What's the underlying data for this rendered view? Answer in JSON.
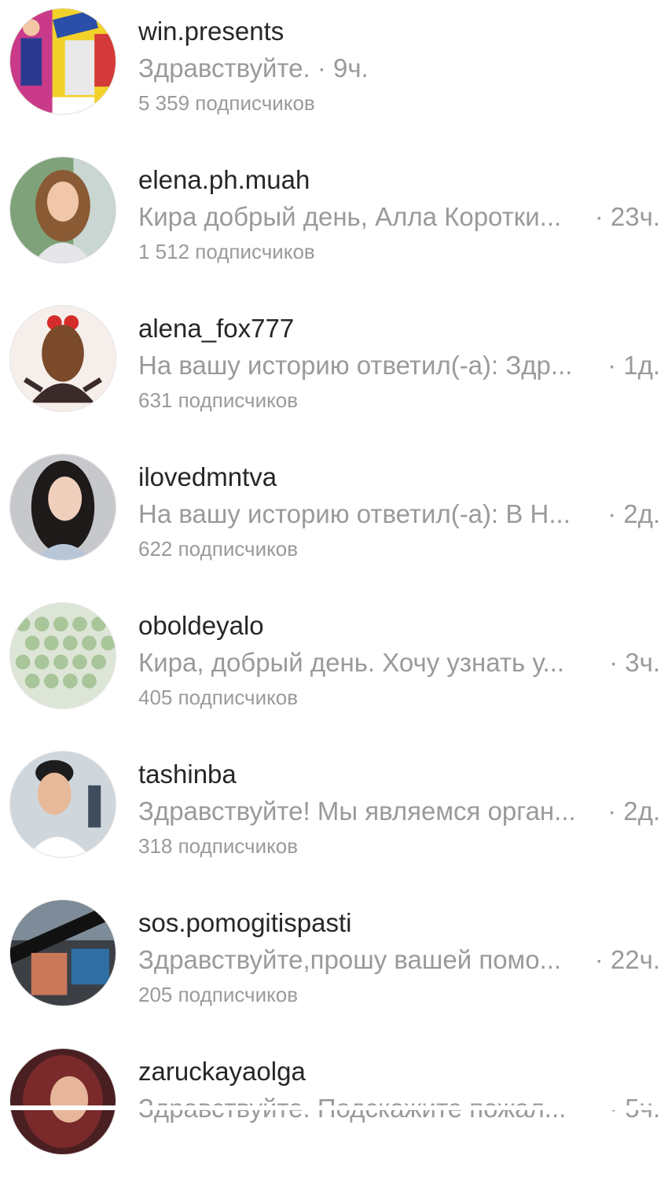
{
  "conversations": [
    {
      "username": "win.presents",
      "preview": "Здравствуйте. · 9ч.",
      "time": "",
      "followers": "5 359 подписчиков",
      "avatar": "product-collage"
    },
    {
      "username": "elena.ph.muah",
      "preview": "Кира добрый день, Алла Коротки...",
      "time": "· 23ч.",
      "followers": "1 512 подписчиков",
      "avatar": "woman-portrait"
    },
    {
      "username": "alena_fox777",
      "preview": "На вашу историю ответил(-а): Здр...",
      "time": "· 1д.",
      "followers": "631 подписчиков",
      "avatar": "illustration-girl"
    },
    {
      "username": "ilovedmntva",
      "preview": "На вашу историю ответил(-а): В Н...",
      "time": "· 2д.",
      "followers": "622 подписчиков",
      "avatar": "woman-portrait-dark"
    },
    {
      "username": "oboldeyalo",
      "preview": "Кира, добрый день. Хочу узнать у...",
      "time": "· 3ч.",
      "followers": "405 подписчиков",
      "avatar": "green-pattern"
    },
    {
      "username": "tashinba",
      "preview": "Здравствуйте! Мы являемся орган...",
      "time": "· 2д.",
      "followers": "318 подписчиков",
      "avatar": "man-portrait"
    },
    {
      "username": "sos.pomogitispasti",
      "preview": "Здравствуйте,прошу вашей помо...",
      "time": "· 22ч.",
      "followers": "205 подписчиков",
      "avatar": "photo-collage"
    },
    {
      "username": "zaruckayaolga",
      "preview": "Здравствуйте. Подскажите пожал...",
      "time": "· 5ч.",
      "followers": "",
      "avatar": "woman-portrait-red"
    }
  ]
}
